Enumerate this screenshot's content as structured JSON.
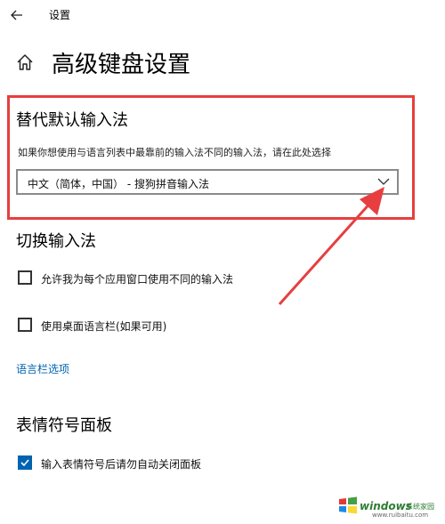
{
  "window": {
    "title": "设置"
  },
  "header": {
    "title": "高级键盘设置"
  },
  "sections": {
    "override": {
      "heading": "替代默认输入法",
      "description": "如果你想使用与语言列表中最靠前的输入法不同的输入法，请在此处选择",
      "dropdown_value": "中文（简体，中国） - 搜狗拼音输入法"
    },
    "switching": {
      "heading": "切换输入法",
      "options": [
        {
          "label": "允许我为每个应用窗口使用不同的输入法",
          "checked": false
        },
        {
          "label": "使用桌面语言栏(如果可用)",
          "checked": false
        }
      ],
      "link": "语言栏选项"
    },
    "emoji": {
      "heading": "表情符号面板",
      "options": [
        {
          "label": "输入表情符号后请勿自动关闭面板",
          "checked": true
        }
      ]
    }
  },
  "annotation": {
    "highlight_color": "#e73f3f"
  },
  "watermark": {
    "brand": "windows",
    "suffix": "系统家园",
    "url": "www.ruibaitu.com"
  },
  "colors": {
    "accent": "#0063b1"
  }
}
